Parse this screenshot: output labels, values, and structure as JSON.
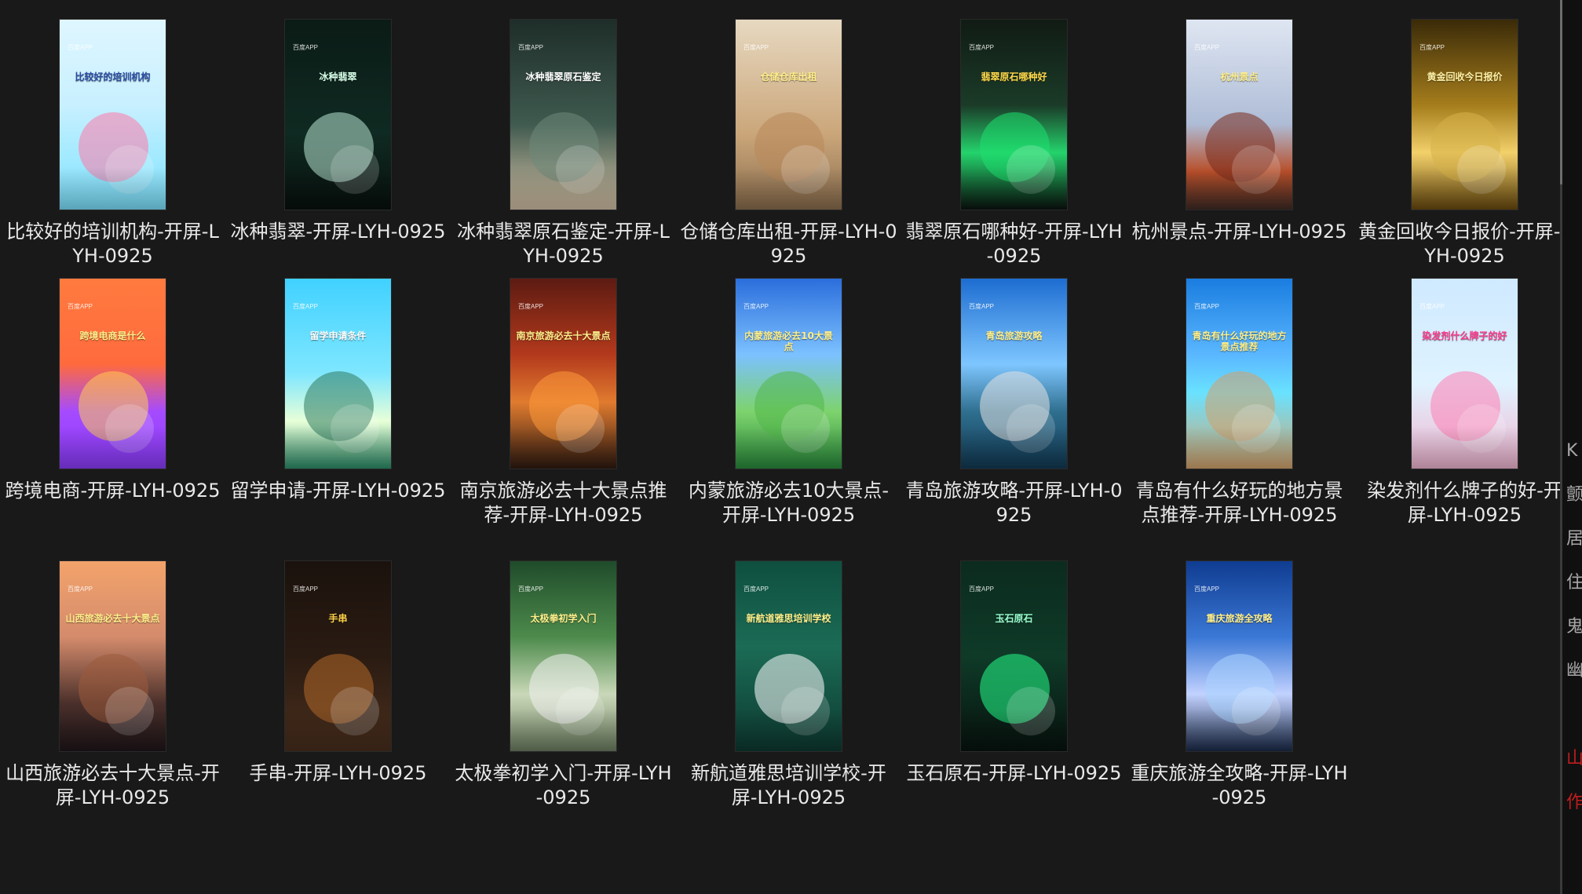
{
  "tiles": [
    {
      "label": "比较好的培训机构-开屏-LYH-0925",
      "thumb": {
        "title": "比较好的培训机构",
        "badge": "百度APP",
        "bg": "linear-gradient(180deg,#dff6ff 0%,#c8f0ff 45%,#7de3ff 100%)",
        "title_color": "#2b4fa5",
        "shape_color": "#ff7aa8"
      }
    },
    {
      "label": "冰种翡翠-开屏-LYH-0925",
      "thumb": {
        "title": "冰种翡翠",
        "badge": "百度APP",
        "bg": "linear-gradient(180deg,#0b1b16 0%,#0f2a22 60%,#08100d 100%)",
        "title_color": "#d7ffe8",
        "shape_color": "#b8e6d3"
      }
    },
    {
      "label": "冰种翡翠原石鉴定-开屏-LYH-0925",
      "thumb": {
        "title": "冰种翡翠原石鉴定",
        "badge": "百度APP",
        "bg": "linear-gradient(180deg,#1e2d29 0%,#3f5a4f 55%,#d6c3a7 100%)",
        "title_color": "#ffffff",
        "shape_color": "#6f8a7b"
      }
    },
    {
      "label": "仓储仓库出租-开屏-LYH-0925",
      "thumb": {
        "title": "仓储仓库出租",
        "badge": "百度APP",
        "bg": "linear-gradient(180deg,#e7d9c1 0%,#cba67a 60%,#8b6e4e 100%)",
        "title_color": "#ffef8a",
        "shape_color": "#b9895a"
      }
    },
    {
      "label": "翡翠原石哪种好-开屏-LYH-0925",
      "thumb": {
        "title": "翡翠原石哪种好",
        "badge": "百度APP",
        "bg": "linear-gradient(180deg,#101b14 0%,#1b3b28 45%,#24d36c 70%,#0b130f 100%)",
        "title_color": "#ffd84a",
        "shape_color": "#1ee06f"
      }
    },
    {
      "label": "杭州景点-开屏-LYH-0925",
      "thumb": {
        "title": "杭州景点",
        "badge": "百度APP",
        "bg": "linear-gradient(180deg,#dfe6f2 0%,#aebcd6 55%,#b84f2a 80%,#3f2b25 100%)",
        "title_color": "#ffef8a",
        "shape_color": "#7a2b1c"
      }
    },
    {
      "label": "黄金回收今日报价-开屏-LYH-0925",
      "thumb": {
        "title": "黄金回收今日报价",
        "badge": "百度APP",
        "bg": "linear-gradient(180deg,#3a2a08 0%,#a57d1c 45%,#f2d06a 70%,#6b4b0f 100%)",
        "title_color": "#fff2a6",
        "shape_color": "#d6b24a"
      }
    },
    {
      "label": "跨境电商-开屏-LYH-0925",
      "thumb": {
        "title": "跨境电商是什么",
        "badge": "百度APP",
        "bg": "linear-gradient(180deg,#ff7b3f 0%,#ff6a3d 45%,#a54bff 70%,#8d3dff 100%)",
        "title_color": "#ffef8a",
        "shape_color": "#ffcc55"
      }
    },
    {
      "label": "留学申请-开屏-LYH-0925",
      "thumb": {
        "title": "留学申请条件",
        "badge": "百度APP",
        "bg": "linear-gradient(180deg,#40d1ff 0%,#7fe7ff 50%,#e8ffd8 75%,#2b8f6a 100%)",
        "title_color": "#ffffff",
        "shape_color": "#2f7b5f"
      }
    },
    {
      "label": "南京旅游必去十大景点推荐-开屏-LYH-0925",
      "thumb": {
        "title": "南京旅游必去十大景点",
        "badge": "百度APP",
        "bg": "linear-gradient(180deg,#5d1b12 0%,#b3391c 40%,#e07b2f 65%,#2f1a10 100%)",
        "title_color": "#ffef8a",
        "shape_color": "#ff9a3a"
      }
    },
    {
      "label": "内蒙旅游必去10大景点-开屏-LYH-0925",
      "thumb": {
        "title": "内蒙旅游必去10大景点",
        "badge": "百度APP",
        "bg": "linear-gradient(180deg,#2b6edc 0%,#7cc1ff 40%,#7dd36d 70%,#2a8c3d 100%)",
        "title_color": "#ffef8a",
        "shape_color": "#53b84a"
      }
    },
    {
      "label": "青岛旅游攻略-开屏-LYH-0925",
      "thumb": {
        "title": "青岛旅游攻略",
        "badge": "百度APP",
        "bg": "linear-gradient(180deg,#1d6dd1 0%,#7ec6ff 45%,#2f6f8f 70%,#123a55 100%)",
        "title_color": "#ffef8a",
        "shape_color": "#e3e3e3"
      }
    },
    {
      "label": "青岛有什么好玩的地方景点推荐-开屏-LYH-0925",
      "thumb": {
        "title": "青岛有什么好玩的地方景点推荐",
        "badge": "百度APP",
        "bg": "linear-gradient(180deg,#1a7de0 0%,#5ab7ff 40%,#69e2ff 60%,#d7a56d 100%)",
        "title_color": "#ffef8a",
        "shape_color": "#d3a16b"
      }
    },
    {
      "label": "染发剂什么牌子的好-开屏-LYH-0925",
      "thumb": {
        "title": "染发剂什么牌子的好",
        "badge": "百度APP",
        "bg": "linear-gradient(180deg,#cfe9ff 0%,#dff3ff 55%,#f2b6d2 100%)",
        "title_color": "#ff3b8e",
        "shape_color": "#ff7fb4"
      }
    },
    {
      "label": "山西旅游必去十大景点-开屏-LYH-0925",
      "thumb": {
        "title": "山西旅游必去十大景点",
        "badge": "百度APP",
        "bg": "linear-gradient(180deg,#f3a36b 0%,#d48b6c 40%,#4a2f2a 75%,#20161a 100%)",
        "title_color": "#ffef8a",
        "shape_color": "#9c5b3c"
      }
    },
    {
      "label": "手串-开屏-LYH-0925",
      "thumb": {
        "title": "手串",
        "badge": "百度APP",
        "bg": "linear-gradient(180deg,#1b120d 0%,#2a1b12 50%,#4a2f1d 100%)",
        "title_color": "#ffd24a",
        "shape_color": "#b46a2a"
      }
    },
    {
      "label": "太极拳初学入门-开屏-LYH-0925",
      "thumb": {
        "title": "太极拳初学入门",
        "badge": "百度APP",
        "bg": "linear-gradient(180deg,#1f4b2a 0%,#4d8b4c 40%,#c9d8b8 70%,#6e7f62 100%)",
        "title_color": "#ffef8a",
        "shape_color": "#f2f2f2"
      }
    },
    {
      "label": "新航道雅思培训学校-开屏-LYH-0925",
      "thumb": {
        "title": "新航道雅思培训学校",
        "badge": "百度APP",
        "bg": "linear-gradient(180deg,#0f4f3f 0%,#1b6b55 45%,#0d3a31 100%)",
        "title_color": "#ffef8a",
        "shape_color": "#ffffff"
      }
    },
    {
      "label": "玉石原石-开屏-LYH-0925",
      "thumb": {
        "title": "玉石原石",
        "badge": "百度APP",
        "bg": "linear-gradient(180deg,#0b2b1e 0%,#0f3a28 50%,#07130e 100%)",
        "title_color": "#9bffcf",
        "shape_color": "#24ff8a"
      }
    },
    {
      "label": "重庆旅游全攻略-开屏-LYH-0925",
      "thumb": {
        "title": "重庆旅游全攻略",
        "badge": "百度APP",
        "bg": "linear-gradient(180deg,#0f3c91 0%,#3b78d6 40%,#c2d2ff 70%,#1b2b4a 100%)",
        "title_color": "#ffef8a",
        "shape_color": "#a9d3ff"
      }
    }
  ],
  "side_chars": [
    "K",
    "颤",
    "居",
    "住",
    "鬼",
    "幽",
    "山",
    "作"
  ]
}
